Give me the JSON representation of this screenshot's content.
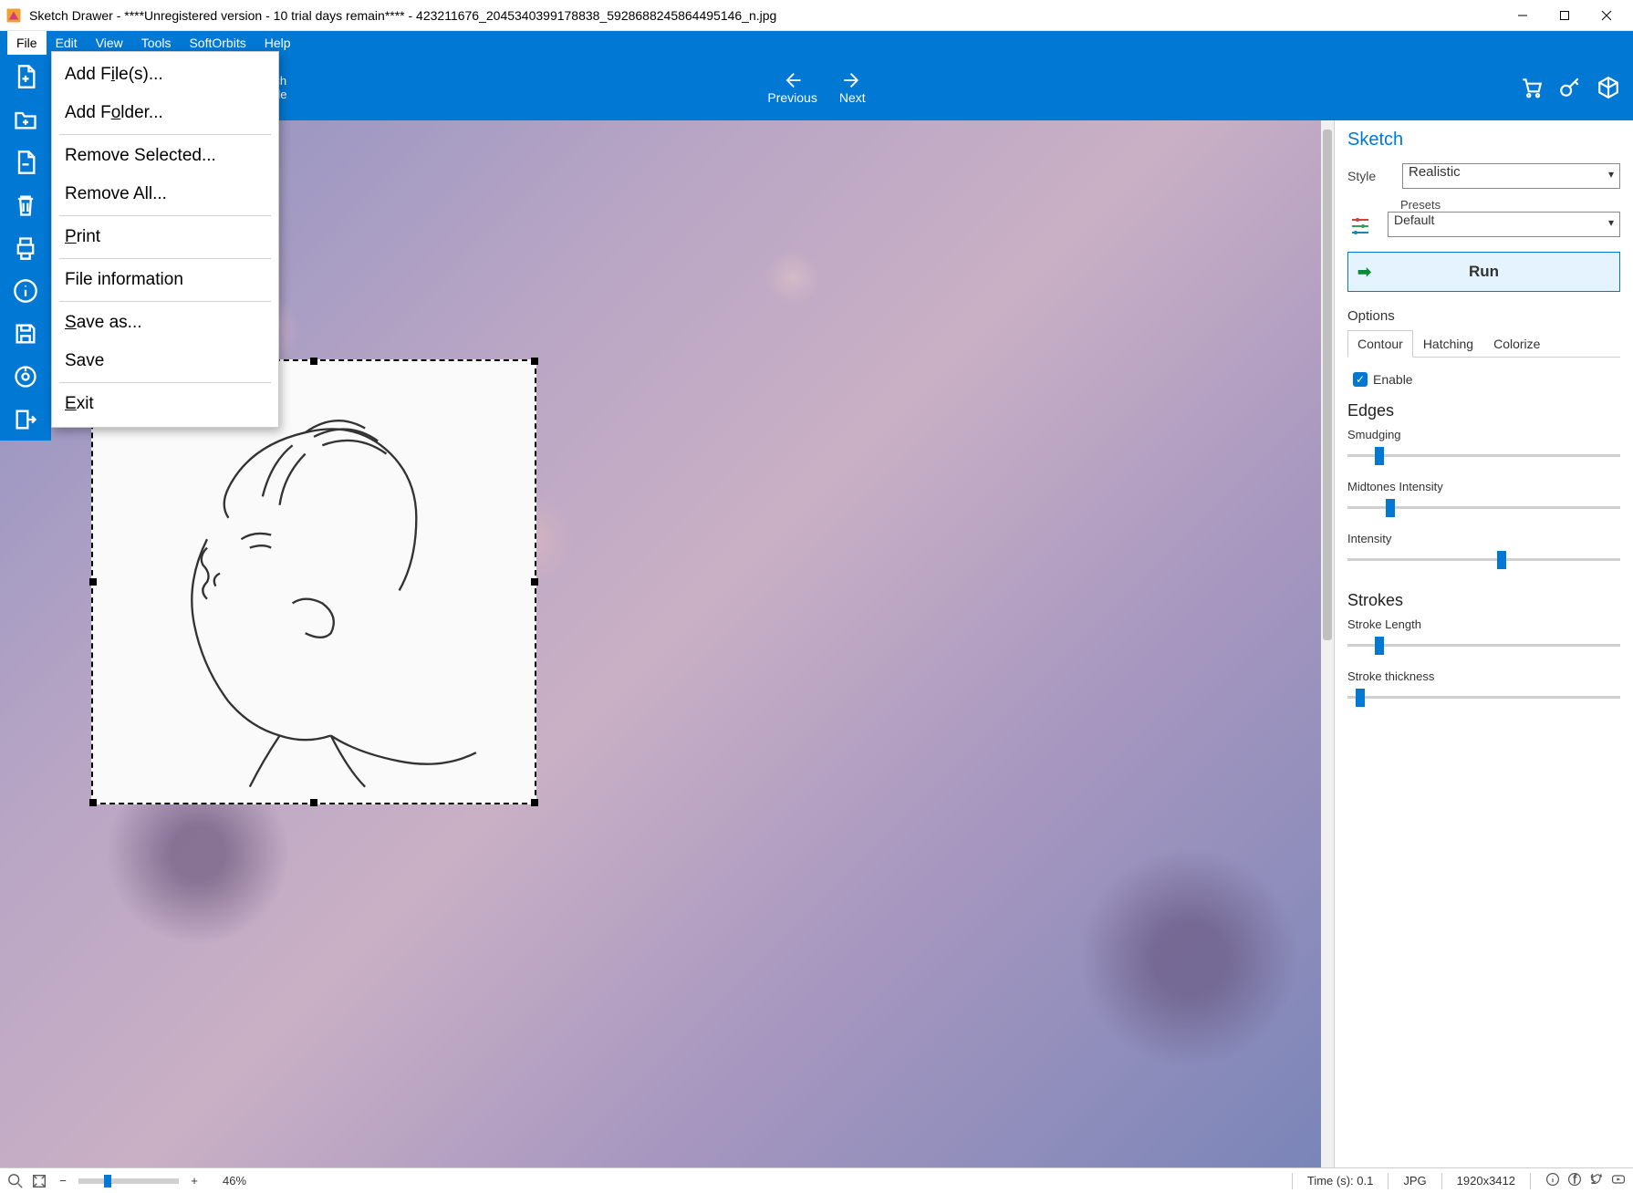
{
  "window": {
    "title": "Sketch Drawer - ****Unregistered version - 10 trial days remain**** - 423211676_2045340399178838_5928688245864495146_n.jpg"
  },
  "menubar": [
    "File",
    "Edit",
    "View",
    "Tools",
    "SoftOrbits",
    "Help"
  ],
  "file_menu": {
    "add_files": "Add File(s)...",
    "add_folder": "Add Folder...",
    "remove_selected": "Remove Selected...",
    "remove_all": "Remove All...",
    "print": "Print",
    "file_info": "File information",
    "save_as": "Save as...",
    "save": "Save",
    "exit": "Exit"
  },
  "ribbon": {
    "mode_line1": "ch",
    "mode_line2": "de",
    "prev": "Previous",
    "next": "Next"
  },
  "right_panel": {
    "title": "Sketch",
    "style_label": "Style",
    "style_value": "Realistic",
    "presets_label": "Presets",
    "presets_value": "Default",
    "run": "Run",
    "options": "Options",
    "tabs": {
      "contour": "Contour",
      "hatching": "Hatching",
      "colorize": "Colorize"
    },
    "enable": "Enable",
    "edges_title": "Edges",
    "smudging": "Smudging",
    "midtones": "Midtones Intensity",
    "intensity": "Intensity",
    "strokes_title": "Strokes",
    "stroke_length": "Stroke Length",
    "stroke_thickness": "Stroke thickness",
    "sliders": {
      "smudging_pct": 10,
      "midtones_pct": 14,
      "intensity_pct": 55,
      "stroke_length_pct": 10,
      "stroke_thickness_pct": 3
    }
  },
  "statusbar": {
    "zoom": "46%",
    "time": "Time (s): 0.1",
    "format": "JPG",
    "dimensions": "1920x3412"
  }
}
